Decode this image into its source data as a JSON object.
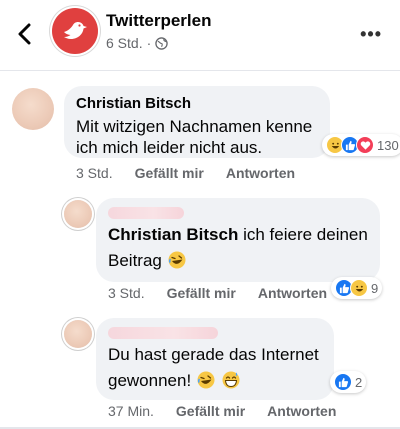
{
  "header": {
    "page_name": "Twitterperlen",
    "timestamp": "6 Std.",
    "audience_icon": "globe-icon",
    "back_icon": "chevron-left-icon",
    "more_label": "•••"
  },
  "comments": [
    {
      "author": "Christian Bitsch",
      "text_line1": "Mit witzigen Nachnamen kenne",
      "text_line2": "ich mich leider nicht aus.",
      "reactions": [
        "haha",
        "like",
        "love"
      ],
      "reaction_count": "130",
      "time": "3 Std.",
      "like_label": "Gefällt mir",
      "reply_label": "Antworten"
    }
  ],
  "replies": [
    {
      "author_blurred": true,
      "mention": "Christian Bitsch",
      "text_rest": " ich feiere deinen",
      "text_line2": "Beitrag",
      "emojis": [
        "rofl"
      ],
      "reactions": [
        "like",
        "haha"
      ],
      "reaction_count": "9",
      "time": "3 Std.",
      "like_label": "Gefällt mir",
      "reply_label": "Antworten"
    },
    {
      "author_blurred": true,
      "text_line1": "Du hast gerade das Internet",
      "text_line2": "gewonnen!",
      "emojis": [
        "rofl",
        "grin-sweat"
      ],
      "reactions": [
        "like"
      ],
      "reaction_count": "2",
      "time": "37 Min.",
      "like_label": "Gefällt mir",
      "reply_label": "Antworten"
    }
  ],
  "colors": {
    "brand_red": "#e0403f",
    "bubble_bg": "#f0f2f5",
    "meta_gray": "#65676b",
    "like_blue": "#1877f2",
    "love_red": "#f33e58",
    "haha_yellow": "#f7c744"
  }
}
